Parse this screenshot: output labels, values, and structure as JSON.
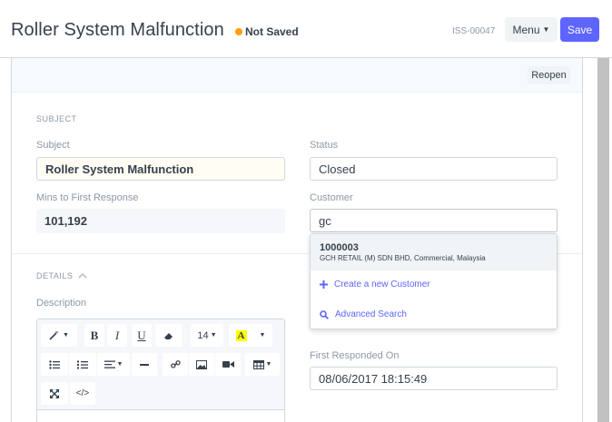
{
  "header": {
    "title": "Roller System Malfunction",
    "status": "Not Saved",
    "doc_id": "ISS-00047",
    "menu_label": "Menu",
    "save_label": "Save"
  },
  "reopen_label": "Reopen",
  "subject_section": {
    "heading": "SUBJECT",
    "subject_label": "Subject",
    "subject_value": "Roller System Malfunction",
    "status_label": "Status",
    "status_value": "Closed",
    "mins_label": "Mins to First Response",
    "mins_value": "101,192",
    "customer_label": "Customer",
    "customer_value": "gc"
  },
  "customer_dropdown": {
    "result_code": "1000003",
    "result_desc": "GCH RETAIL (M) SDN BHD, Commercial, Malaysia",
    "create_label": "Create a new Customer",
    "advanced_label": "Advanced Search"
  },
  "details_section": {
    "heading": "DETAILS",
    "description_label": "Description",
    "first_responded_label": "First Responded On",
    "first_responded_value": "08/06/2017 18:15:49"
  },
  "editor_toolbar": {
    "font_size": "14"
  },
  "colors": {
    "primary": "#5e64ff",
    "not_saved_dot": "#ffa00a"
  }
}
